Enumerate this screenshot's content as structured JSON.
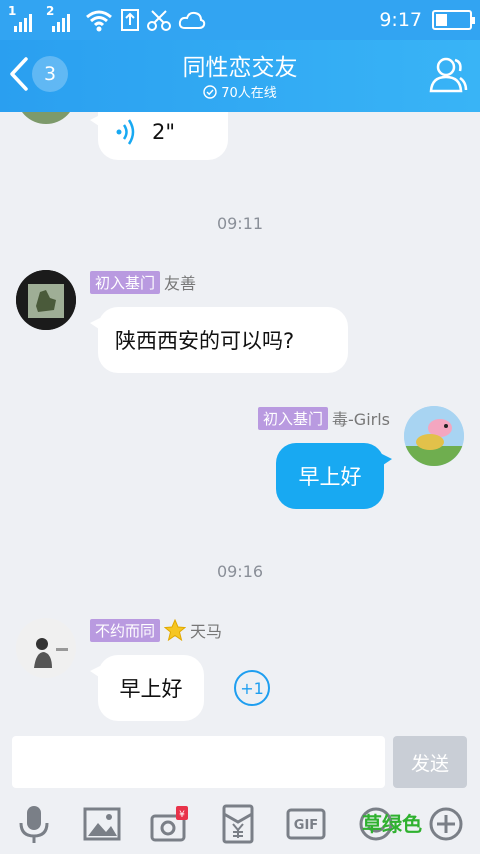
{
  "status_bar": {
    "sim1": "1",
    "sim2": "2",
    "time": "9:17"
  },
  "header": {
    "back_count": "3",
    "title": "同性恋交友",
    "online": "70人在线"
  },
  "messages": {
    "voice": {
      "duration": "2\""
    },
    "time1": "09:11",
    "msg1": {
      "badge": "初入基门",
      "name": "友善",
      "text": "陕西西安的可以吗?"
    },
    "msg2": {
      "badge": "初入基门",
      "name": "毒-Girls",
      "text": "早上好"
    },
    "time2": "09:16",
    "msg3": {
      "badge": "不约而同",
      "name": "天马",
      "text": "早上好",
      "plus_one": "+1"
    }
  },
  "input": {
    "placeholder": "",
    "send_label": "发送"
  },
  "toolbar": {
    "gif_label": "GIF",
    "yen_label": "¥"
  },
  "watermark": "草绿色",
  "colors": {
    "brand_blue": "#32a4f2",
    "bubble_out": "#18a9f2",
    "badge_purple": "#b99ae0"
  }
}
